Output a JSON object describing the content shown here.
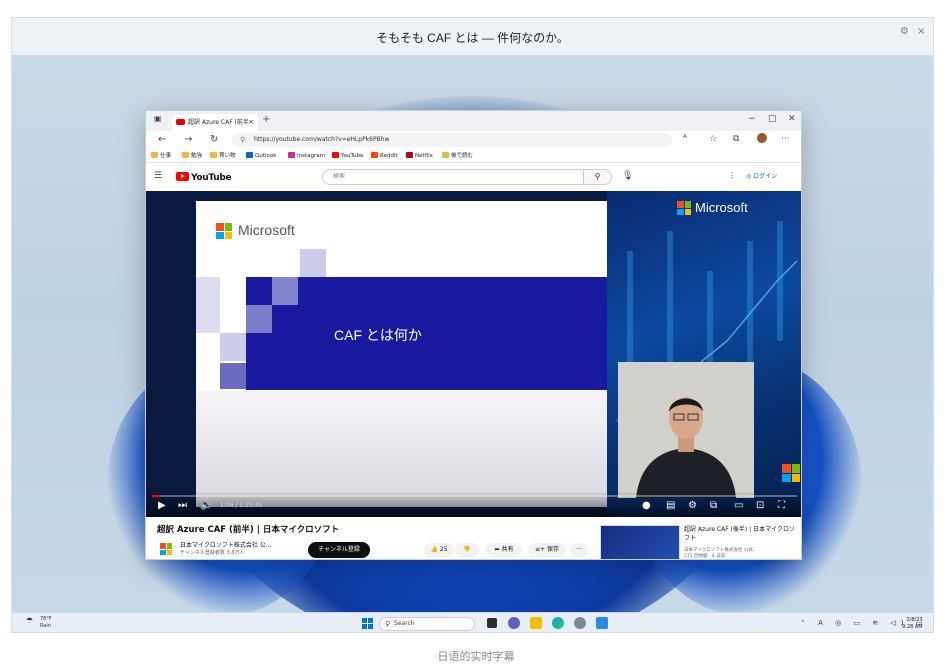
{
  "caption_bar": {
    "text": "そもそも CAF とは — 件何なのか。",
    "settings_glyph": "⚙",
    "close_glyph": "×"
  },
  "browser": {
    "tab_title": "超訳 Azure CAF (前半",
    "tab_close": "×",
    "new_tab": "+",
    "window_controls": [
      "−",
      "▢",
      "✕"
    ],
    "url": "https://youtube.com/watch?v=eHLpPk6PBhw",
    "favorites": [
      {
        "label": "仕事",
        "color": "#e8b84a"
      },
      {
        "label": "勉強",
        "color": "#e8b84a"
      },
      {
        "label": "買い物",
        "color": "#e8b84a"
      },
      {
        "label": "Outlook",
        "color": "#0a64c8"
      },
      {
        "label": "Instagram",
        "color": "#d6249f"
      },
      {
        "label": "YouTube",
        "color": "#ff0000"
      },
      {
        "label": "Reddit",
        "color": "#ff4500"
      },
      {
        "label": "Netflix",
        "color": "#b00610"
      },
      {
        "label": "後で読む",
        "color": "#e8b84a"
      }
    ]
  },
  "youtube": {
    "logo": "YouTube",
    "search_placeholder": "検索",
    "login": "ログイン",
    "slide": {
      "brand": "Microsoft",
      "title": "CAF とは何か",
      "right_brand": "Microsoft"
    },
    "player": {
      "time": "1:04 / 1:25:45",
      "progress": 0.013
    },
    "video_title": "超訳 Azure CAF (前半) | 日本マイクロソフト",
    "channel": "日本マイクロソフト株式会社 公...",
    "subscribers": "チャンネル登録者数 3.8万人",
    "subscribe": "チャンネル登録",
    "likes": "25",
    "share": "共有",
    "save": "保存",
    "more": "···",
    "related": {
      "title": "超訳 Azure CAF (後半) | 日本マイクロソフト",
      "channel": "日本マイクロソフト株式会社 公式...",
      "meta": "271 回視聴 · 4 日前"
    }
  },
  "taskbar": {
    "weather_temp": "78°F",
    "weather_cond": "Rain",
    "search": "Search",
    "tray": "⌃ A ◎ ▭ ≋ ◁) ▭",
    "date": "2/8/23",
    "time": "9:28 AM"
  },
  "caption": "日语的实时字幕",
  "colors": {
    "yt_red": "#ff0000",
    "slide_blue": "#1a1aa0",
    "ms_red": "#f25022",
    "ms_green": "#7fba00",
    "ms_blue": "#00a4ef",
    "ms_yellow": "#ffb900"
  }
}
